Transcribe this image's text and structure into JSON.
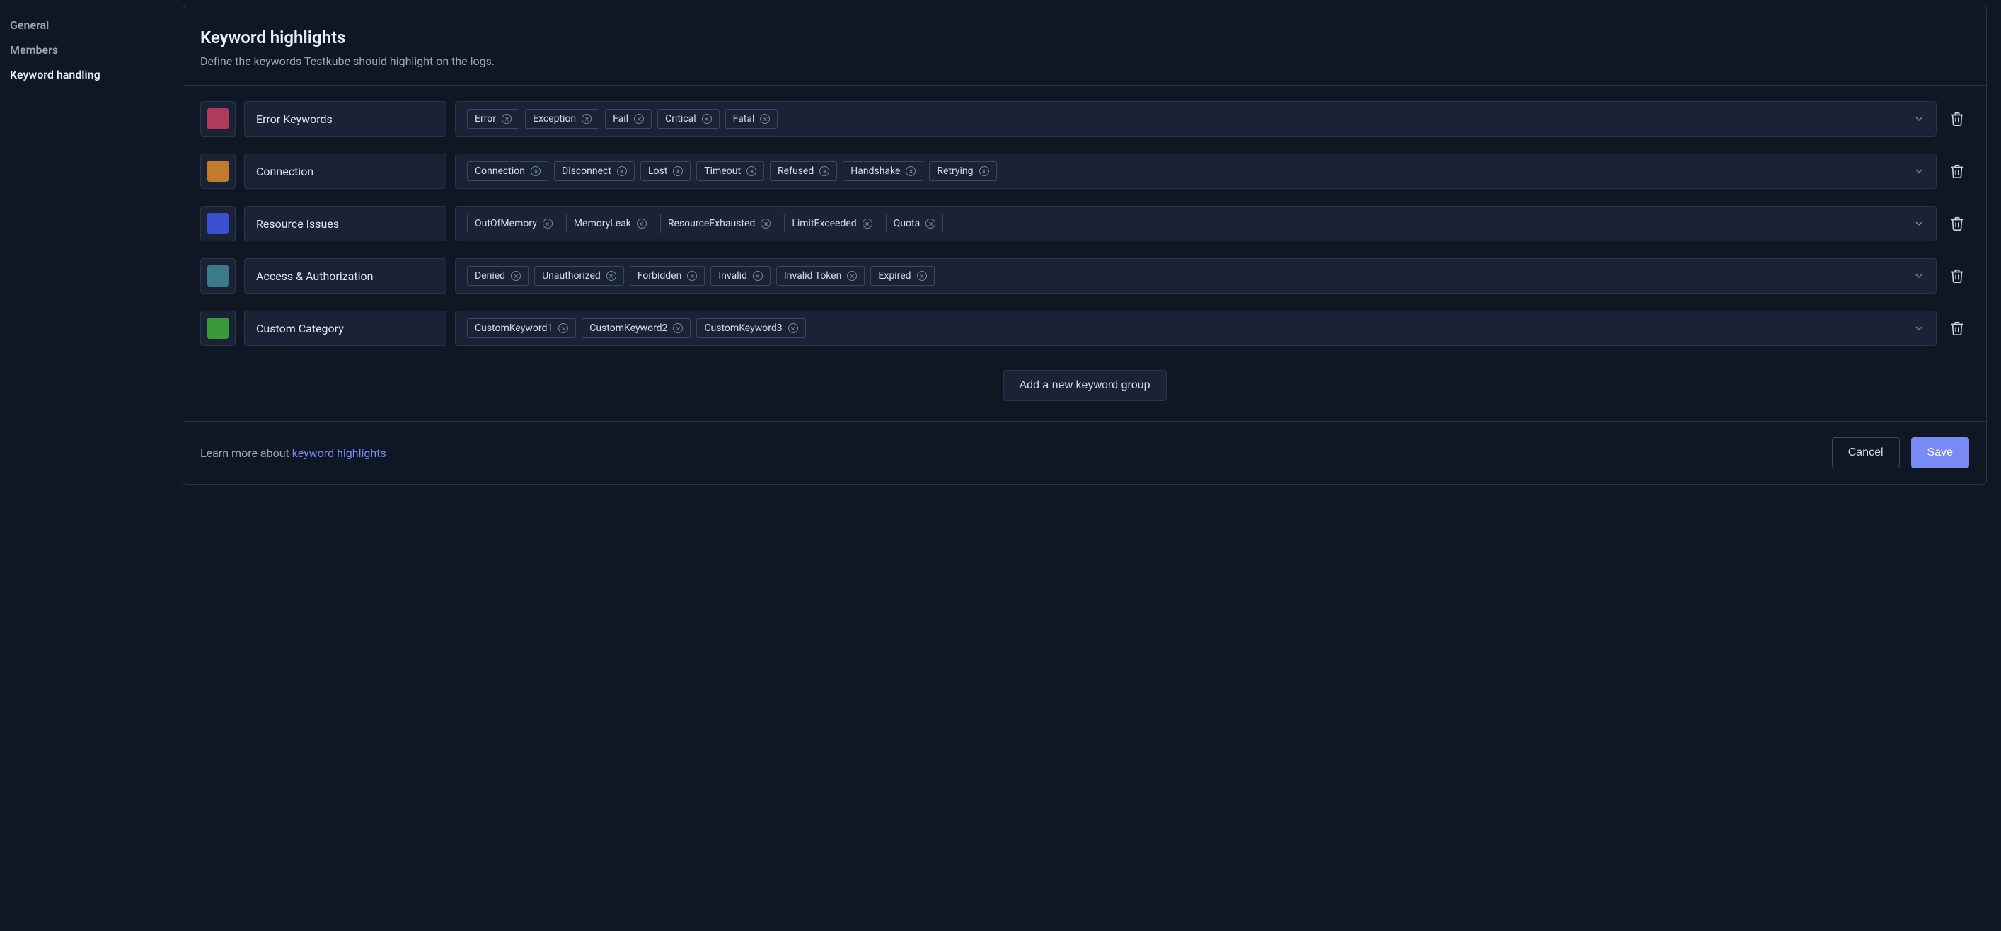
{
  "sidebar": {
    "items": [
      {
        "label": "General",
        "active": false
      },
      {
        "label": "Members",
        "active": false
      },
      {
        "label": "Keyword handling",
        "active": true
      }
    ]
  },
  "header": {
    "title": "Keyword highlights",
    "subtitle": "Define the keywords Testkube should highlight on the logs."
  },
  "groups": [
    {
      "color": "#b03a5b",
      "name": "Error Keywords",
      "keywords": [
        "Error",
        "Exception",
        "Fail",
        "Critical",
        "Fatal"
      ]
    },
    {
      "color": "#c27a2c",
      "name": "Connection",
      "keywords": [
        "Connection",
        "Disconnect",
        "Lost",
        "Timeout",
        "Refused",
        "Handshake",
        "Retrying"
      ]
    },
    {
      "color": "#3a4fd0",
      "name": "Resource Issues",
      "keywords": [
        "OutOfMemory",
        "MemoryLeak",
        "ResourceExhausted",
        "LimitExceeded",
        "Quota"
      ]
    },
    {
      "color": "#3a7a8a",
      "name": "Access & Authorization",
      "keywords": [
        "Denied",
        "Unauthorized",
        "Forbidden",
        "Invalid",
        "Invalid Token",
        "Expired"
      ]
    },
    {
      "color": "#3a9a3a",
      "name": "Custom Category",
      "keywords": [
        "CustomKeyword1",
        "CustomKeyword2",
        "CustomKeyword3"
      ]
    }
  ],
  "addGroupLabel": "Add a new keyword group",
  "footer": {
    "learnPrefix": "Learn more about ",
    "learnLink": "keyword highlights",
    "cancel": "Cancel",
    "save": "Save"
  }
}
